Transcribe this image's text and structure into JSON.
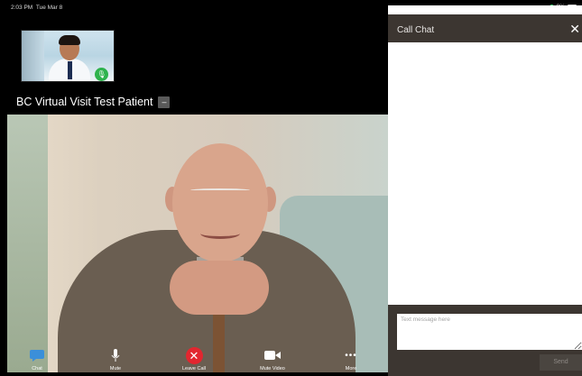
{
  "status_bar": {
    "time": "2:03 PM",
    "date": "Tue Mar 8",
    "battery": "9%"
  },
  "call": {
    "patient_name": "BC Virtual Visit Test Patient",
    "name_tag": "–"
  },
  "toolbar": {
    "chat": "Chat",
    "mute": "Mute",
    "leave": "Leave Call",
    "mute_video": "Mute Video",
    "more": "More"
  },
  "chat": {
    "title": "Call Chat",
    "close": "✕",
    "placeholder": "Text message here",
    "send": "Send"
  },
  "colors": {
    "leave_red": "#e2262f",
    "panel_header": "#3c3631",
    "mic_green": "#2eb24d"
  }
}
